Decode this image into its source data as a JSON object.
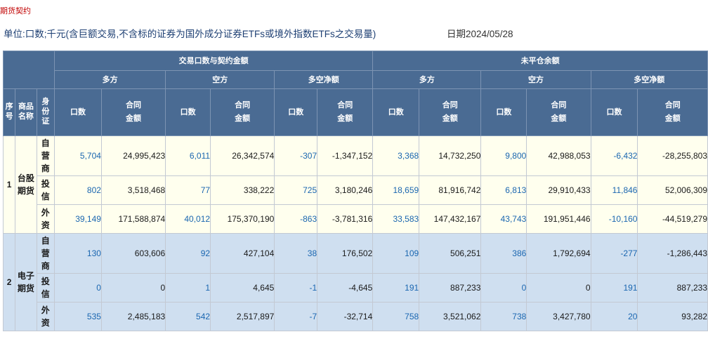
{
  "breadcrumb": "期货契约",
  "unit_text": "单位:口数;千元(含巨额交易,不含标的证券为国外成分证券ETFs或境外指数ETFs之交易量)",
  "date_text": "日期2024/05/28",
  "headers": {
    "group_trade": "交易口数与契约金额",
    "group_oi": "未平仓余额",
    "long": "多方",
    "short": "空方",
    "net": "多空净额",
    "seq": "序号",
    "product": "商品名称",
    "identity": "身份证",
    "lots": "口数",
    "amount_line1": "合同",
    "amount_line2": "金额"
  },
  "groups": [
    {
      "seq": "1",
      "name_line1": "台股",
      "name_line2": "期货",
      "rows": [
        {
          "id_label": "自营商",
          "vals": [
            "5,704",
            "24,995,423",
            "6,011",
            "26,342,574",
            "-307",
            "-1,347,152",
            "3,368",
            "14,732,250",
            "9,800",
            "42,988,053",
            "-6,432",
            "-28,255,803"
          ]
        },
        {
          "id_label": "投信",
          "vals": [
            "802",
            "3,518,468",
            "77",
            "338,222",
            "725",
            "3,180,246",
            "18,659",
            "81,916,742",
            "6,813",
            "29,910,433",
            "11,846",
            "52,006,309"
          ]
        },
        {
          "id_label": "外资",
          "vals": [
            "39,149",
            "171,588,874",
            "40,012",
            "175,370,190",
            "-863",
            "-3,781,316",
            "33,583",
            "147,432,167",
            "43,743",
            "191,951,446",
            "-10,160",
            "-44,519,279"
          ]
        }
      ]
    },
    {
      "seq": "2",
      "name_line1": "电子",
      "name_line2": "期货",
      "rows": [
        {
          "id_label": "自营商",
          "vals": [
            "130",
            "603,606",
            "92",
            "427,104",
            "38",
            "176,502",
            "109",
            "506,251",
            "386",
            "1,792,694",
            "-277",
            "-1,286,443"
          ]
        },
        {
          "id_label": "投信",
          "vals": [
            "0",
            "0",
            "1",
            "4,645",
            "-1",
            "-4,645",
            "191",
            "887,233",
            "0",
            "0",
            "191",
            "887,233"
          ]
        },
        {
          "id_label": "外资",
          "vals": [
            "535",
            "2,485,183",
            "542",
            "2,517,897",
            "-7",
            "-32,714",
            "758",
            "3,521,062",
            "738",
            "3,427,780",
            "20",
            "93,282"
          ]
        }
      ]
    }
  ]
}
